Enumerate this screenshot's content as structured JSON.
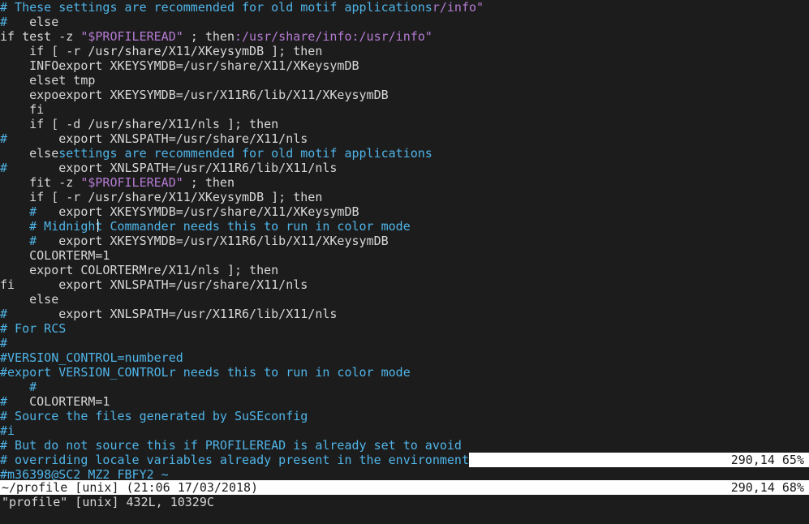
{
  "editor": {
    "lines": [
      [
        {
          "t": "# These settings are recommended for old motif applications",
          "c": "cm"
        },
        {
          "t": "r/info\"",
          "c": "st"
        }
      ],
      [
        {
          "t": "#",
          "c": "cm"
        },
        {
          "t": "   else",
          "c": "tx"
        }
      ],
      [
        {
          "t": "if test -z ",
          "c": "tx"
        },
        {
          "t": "\"$PROFILEREAD\"",
          "c": "st"
        },
        {
          "t": " ; then",
          "c": "tx"
        },
        {
          "t": ":/usr/share/info:/usr/info\"",
          "c": "st"
        }
      ],
      [
        {
          "t": "    if [ -r /usr/share/X11/XKeysymDB ]; then",
          "c": "tx"
        }
      ],
      [
        {
          "t": "    INFOexport XKEYSYMDB=/usr/share/X11/XKeysymDB",
          "c": "tx"
        }
      ],
      [
        {
          "t": "    elset tmp",
          "c": "tx"
        }
      ],
      [
        {
          "t": "    expoexport XKEYSYMDB=/usr/X11R6/lib/X11/XKeysymDB",
          "c": "tx"
        }
      ],
      [
        {
          "t": "    fi",
          "c": "tx"
        }
      ],
      [
        {
          "t": "    if [ -d /usr/share/X11/nls ]; then",
          "c": "tx"
        }
      ],
      [
        {
          "t": "#",
          "c": "cm"
        },
        {
          "t": "       export XNLSPATH=/usr/share/X11/nls",
          "c": "tx"
        }
      ],
      [
        {
          "t": "    else",
          "c": "tx"
        },
        {
          "t": "settings are recommended for old motif applications",
          "c": "cm"
        }
      ],
      [
        {
          "t": "#",
          "c": "cm"
        },
        {
          "t": "       export XNLSPATH=/usr/X11R6/lib/X11/nls",
          "c": "tx"
        }
      ],
      [
        {
          "t": "    fit -z ",
          "c": "tx"
        },
        {
          "t": "\"$PROFILEREAD\"",
          "c": "st"
        },
        {
          "t": " ; then",
          "c": "tx"
        }
      ],
      [
        {
          "t": "    if [ -r /usr/share/X11/XKeysymDB ]; then",
          "c": "tx"
        }
      ],
      [
        {
          "t": "    #",
          "c": "cm"
        },
        {
          "t": "   export XKEYSYMDB=/usr/share/X11/XKeysymDB",
          "c": "tx"
        }
      ],
      [
        {
          "t": "    # Midnight Commander needs this to run in color mode",
          "c": "cm"
        }
      ],
      [
        {
          "t": "    #",
          "c": "cm"
        },
        {
          "t": "   export XKEYSYMDB=/usr/X11R6/lib/X11/XKeysymDB",
          "c": "tx"
        }
      ],
      [
        {
          "t": "    COLORTERM=1",
          "c": "tx"
        }
      ],
      [
        {
          "t": "    export COLORTERMre/X11/nls ]; then",
          "c": "tx"
        }
      ],
      [
        {
          "t": "fi      export XNLSPATH=/usr/share/X11/nls",
          "c": "tx"
        }
      ],
      [
        {
          "t": "    else",
          "c": "tx"
        }
      ],
      [
        {
          "t": "#",
          "c": "cm"
        },
        {
          "t": "       export XNLSPATH=/usr/X11R6/lib/X11/nls",
          "c": "tx"
        }
      ],
      [
        {
          "t": "# For RCS",
          "c": "cm"
        }
      ],
      [
        {
          "t": "#",
          "c": "cm"
        }
      ],
      [
        {
          "t": "#VERSION_CONTROL=numbered",
          "c": "cm"
        }
      ],
      [
        {
          "t": "#export VERSION_CONTROLr needs this to run in color mode",
          "c": "cm"
        }
      ],
      [
        {
          "t": "    #",
          "c": "cm"
        }
      ],
      [
        {
          "t": "#",
          "c": "cm"
        },
        {
          "t": "   COLORTERM=1",
          "c": "tx"
        }
      ],
      [
        {
          "t": "# Source the files generated by SuSEconfig",
          "c": "cm"
        }
      ],
      [
        {
          "t": "#i",
          "c": "cm"
        }
      ],
      [
        {
          "t": "# But do not source this if PROFILEREAD is already set to avoid",
          "c": "cm"
        }
      ],
      [
        {
          "t": "# overriding locale variables already present in the environment",
          "c": "cm"
        }
      ],
      [
        {
          "t": "#m36398@SC2_MZ2_FBFY2 ~",
          "c": "cm"
        }
      ]
    ],
    "inline_ruler": "290,14 65%"
  },
  "statusline": {
    "left": "~/profile [unix] (21:06 17/03/2018)",
    "right": "290,14 68%"
  },
  "cmdline": "\"profile\" [unix] 432L, 10329C",
  "colors": {
    "background": "#1c1c1c",
    "comment": "#4fb4e8",
    "string": "#b57bd3",
    "text": "#d7d7d7",
    "statusbar": "#ffffff"
  }
}
